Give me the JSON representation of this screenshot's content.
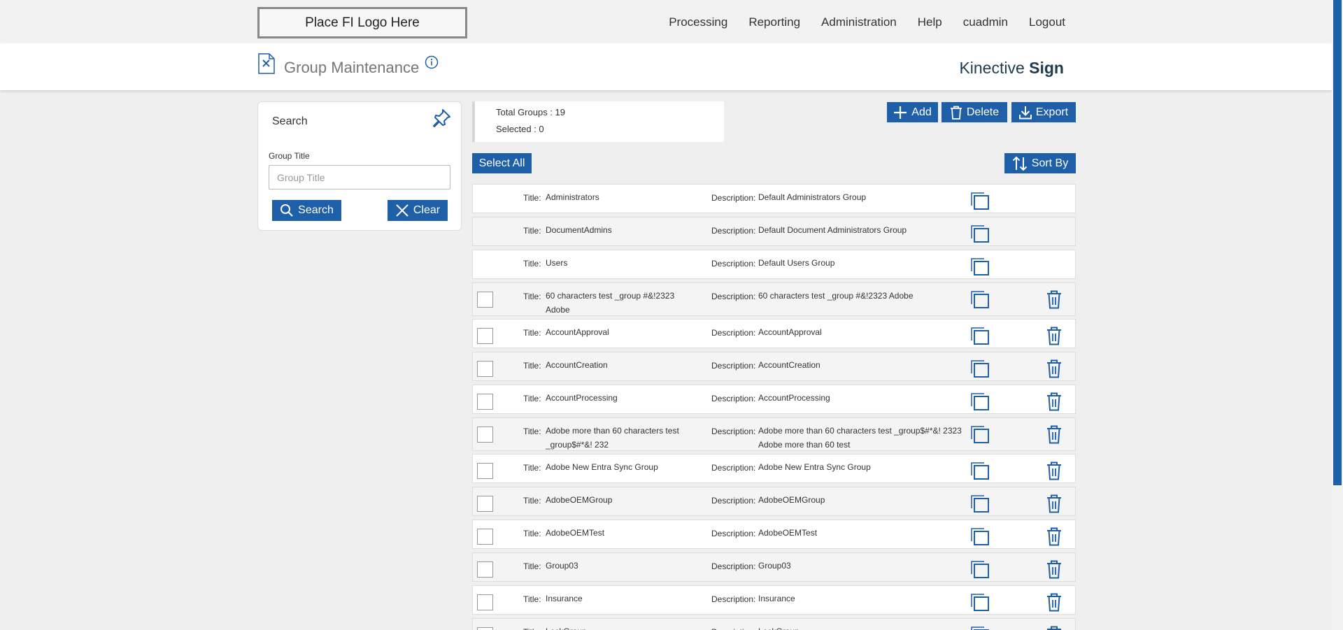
{
  "topbar": {
    "logo_text": "Place FI Logo Here",
    "nav": [
      "Processing",
      "Reporting",
      "Administration",
      "Help",
      "cuadmin",
      "Logout"
    ]
  },
  "header": {
    "title": "Group Maintenance",
    "brand_light": "Kinective ",
    "brand_bold": "Sign"
  },
  "search": {
    "heading": "Search",
    "field_label": "Group Title",
    "placeholder": "Group Title",
    "value": "",
    "search_label": "Search",
    "clear_label": "Clear"
  },
  "summary": {
    "total": "Total Groups : 19",
    "selected": "Selected : 0"
  },
  "toolbar": {
    "add_label": "Add",
    "delete_label": "Delete",
    "export_label": "Export",
    "select_all_label": "Select All",
    "sort_label": "Sort By"
  },
  "labels": {
    "title": "Title:",
    "description": "Description:"
  },
  "groups": [
    {
      "title": "Administrators",
      "description": "Default Administrators Group",
      "system": true
    },
    {
      "title": "DocumentAdmins",
      "description": "Default Document Administrators Group",
      "system": true
    },
    {
      "title": "Users",
      "description": "Default Users Group",
      "system": true
    },
    {
      "title": "60 characters test _group #&!2323 Adobe",
      "description": "60 characters test _group #&!2323 Adobe",
      "system": false
    },
    {
      "title": "AccountApproval",
      "description": "AccountApproval",
      "system": false
    },
    {
      "title": "AccountCreation",
      "description": "AccountCreation",
      "system": false
    },
    {
      "title": "AccountProcessing",
      "description": "AccountProcessing",
      "system": false
    },
    {
      "title": "Adobe more than 60 characters test _group$#*&! 232",
      "description": "Adobe more than 60 characters test _group$#*&! 2323 Adobe more than 60 test",
      "system": false
    },
    {
      "title": "Adobe New Entra Sync Group",
      "description": "Adobe New Entra Sync Group",
      "system": false
    },
    {
      "title": "AdobeOEMGroup",
      "description": "AdobeOEMGroup",
      "system": false
    },
    {
      "title": "AdobeOEMTest",
      "description": "AdobeOEMTest",
      "system": false
    },
    {
      "title": "Group03",
      "description": "Group03",
      "system": false
    },
    {
      "title": "Insurance",
      "description": "Insurance",
      "system": false
    },
    {
      "title": "LockGroup",
      "description": "LockGroup",
      "system": false
    }
  ],
  "colors": {
    "accent": "#1f5fa8",
    "brand_text": "#1f3b4d"
  }
}
